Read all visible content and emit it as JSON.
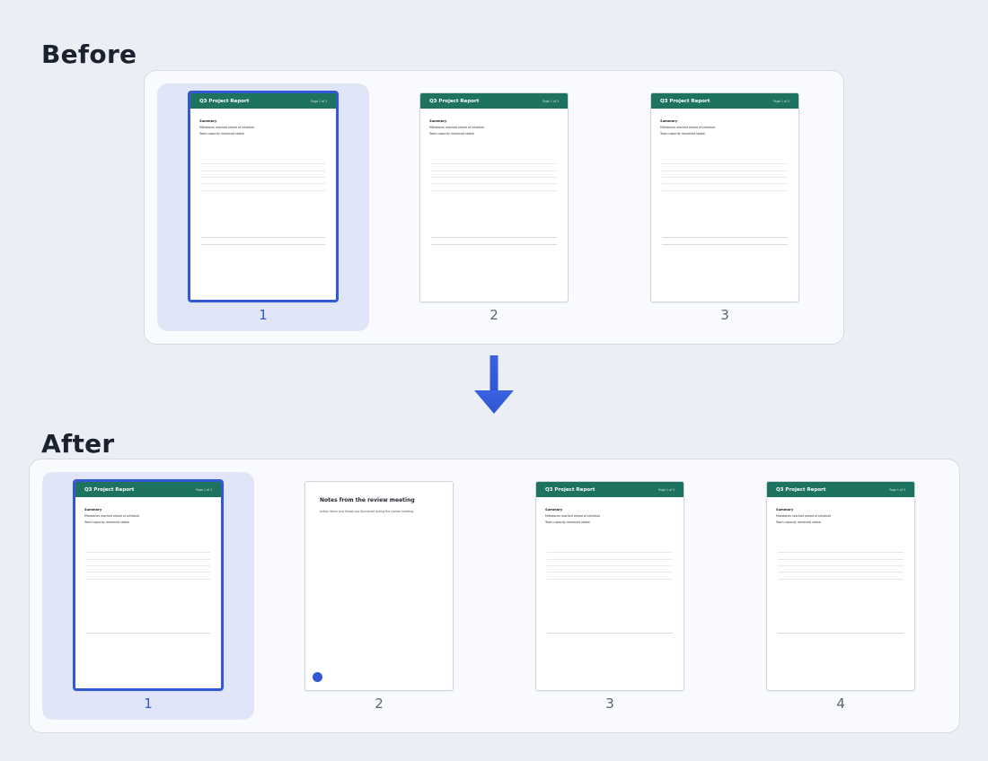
{
  "before": {
    "title": "Before",
    "pages": [
      {
        "number": "1",
        "selected": true,
        "type": "report"
      },
      {
        "number": "2",
        "selected": false,
        "type": "report"
      },
      {
        "number": "3",
        "selected": false,
        "type": "report"
      }
    ]
  },
  "after": {
    "title": "After",
    "pages": [
      {
        "number": "1",
        "selected": true,
        "type": "report"
      },
      {
        "number": "2",
        "selected": false,
        "type": "note"
      },
      {
        "number": "3",
        "selected": false,
        "type": "report"
      },
      {
        "number": "4",
        "selected": false,
        "type": "report"
      }
    ]
  },
  "report_page": {
    "header_title": "Q3 Project Report",
    "header_meta": "Page 1 of 3",
    "body_heading": "Summary",
    "body_lines": [
      "Milestones reached ahead of schedule",
      "Team capacity remained stable"
    ]
  },
  "note_page": {
    "title": "Notes from the review meeting",
    "text": "Action items and follow-ups discussed during the review meeting."
  },
  "colors": {
    "background": "#ebeef5",
    "strip_bg": "#f8fafd",
    "selection_fill": "#e0e6f8",
    "accent": "#3358d4",
    "report_header": "#1d7260"
  },
  "icons": {
    "transition": "arrow-down-icon",
    "note_marker": "blue-dot-marker"
  }
}
